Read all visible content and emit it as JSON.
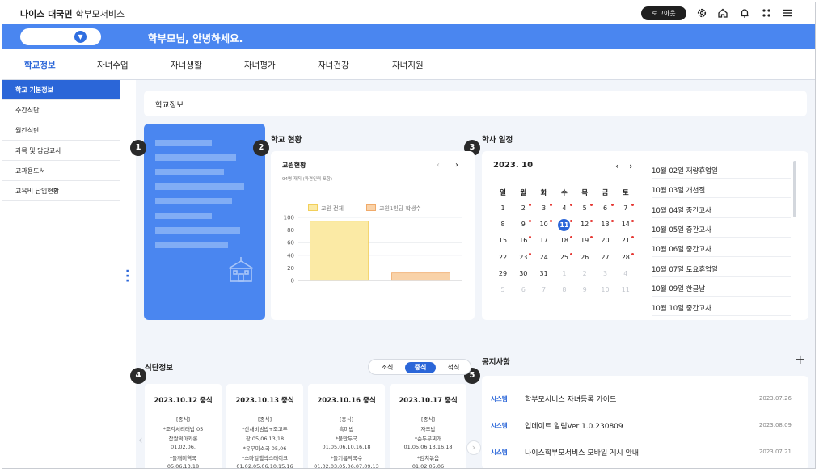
{
  "header": {
    "logo_brand": "나이스 대국민",
    "logo_service": "학부모서비스",
    "login_label": "로그아웃",
    "icons": [
      "gear-icon",
      "home-icon",
      "bell-icon",
      "apps-icon",
      "menu-icon"
    ]
  },
  "banner": {
    "greeting": "학부모님, 안녕하세요."
  },
  "nav": {
    "tabs": [
      {
        "label": "학교정보",
        "active": true
      },
      {
        "label": "자녀수업",
        "active": false
      },
      {
        "label": "자녀생활",
        "active": false
      },
      {
        "label": "자녀평가",
        "active": false
      },
      {
        "label": "자녀건강",
        "active": false
      },
      {
        "label": "자녀지원",
        "active": false
      }
    ]
  },
  "sidebar": {
    "items": [
      {
        "label": "학교 기본정보",
        "active": true
      },
      {
        "label": "주간식단",
        "active": false
      },
      {
        "label": "월간식단",
        "active": false
      },
      {
        "label": "과목 및 담당교사",
        "active": false
      },
      {
        "label": "교과용도서",
        "active": false
      },
      {
        "label": "교육비 납입현황",
        "active": false
      }
    ]
  },
  "page_title": "학교정보",
  "badges": [
    "1",
    "2",
    "3",
    "4",
    "5"
  ],
  "school_status": {
    "title": "학교 현황",
    "card_title": "교원현황",
    "card_sub": "94명 재직 (파견인력 포함)",
    "legend": [
      "교원 전체",
      "교원1인당 학생수"
    ],
    "y_ticks": [
      "100",
      "80",
      "60",
      "40",
      "20",
      "0"
    ]
  },
  "chart_data": {
    "type": "bar",
    "title": "교원현황",
    "categories": [
      "교원 전체",
      "교원1인당 학생수"
    ],
    "series": [
      {
        "name": "교원 전체",
        "values": [
          94,
          null
        ],
        "color": "#fbeaa5"
      },
      {
        "name": "교원1인당 학생수",
        "values": [
          null,
          12
        ],
        "color": "#f9d2a8"
      }
    ],
    "ylim": [
      0,
      100
    ],
    "y_ticks": [
      0,
      20,
      40,
      60,
      80,
      100
    ]
  },
  "calendar": {
    "title": "학사 일정",
    "month_label": "2023. 10",
    "weekdays": [
      "일",
      "월",
      "화",
      "수",
      "목",
      "금",
      "토"
    ],
    "weeks": [
      [
        {
          "d": "1"
        },
        {
          "d": "2",
          "dot": true
        },
        {
          "d": "3",
          "dot": true
        },
        {
          "d": "4",
          "dot": true
        },
        {
          "d": "5",
          "dot": true
        },
        {
          "d": "6",
          "dot": true
        },
        {
          "d": "7",
          "dot": true
        }
      ],
      [
        {
          "d": "8"
        },
        {
          "d": "9",
          "dot": true
        },
        {
          "d": "10",
          "dot": true
        },
        {
          "d": "11",
          "today": true,
          "dot": true
        },
        {
          "d": "12",
          "dot": true
        },
        {
          "d": "13",
          "dot": true
        },
        {
          "d": "14",
          "dot": true
        }
      ],
      [
        {
          "d": "15"
        },
        {
          "d": "16",
          "dot": true
        },
        {
          "d": "17"
        },
        {
          "d": "18",
          "dot": true
        },
        {
          "d": "19",
          "dot": true
        },
        {
          "d": "20"
        },
        {
          "d": "21",
          "dot": true
        }
      ],
      [
        {
          "d": "22"
        },
        {
          "d": "23",
          "dot": true
        },
        {
          "d": "24"
        },
        {
          "d": "25",
          "dot": true
        },
        {
          "d": "26"
        },
        {
          "d": "27"
        },
        {
          "d": "28",
          "dot": true
        }
      ],
      [
        {
          "d": "29"
        },
        {
          "d": "30"
        },
        {
          "d": "31"
        },
        {
          "d": "1",
          "gray": true
        },
        {
          "d": "2",
          "gray": true
        },
        {
          "d": "3",
          "gray": true
        },
        {
          "d": "4",
          "gray": true
        }
      ],
      [
        {
          "d": "5",
          "gray": true
        },
        {
          "d": "6",
          "gray": true
        },
        {
          "d": "7",
          "gray": true
        },
        {
          "d": "8",
          "gray": true
        },
        {
          "d": "9",
          "gray": true
        },
        {
          "d": "10",
          "gray": true
        },
        {
          "d": "11",
          "gray": true
        }
      ]
    ],
    "events": [
      "10월 02일 재량휴업일",
      "10월 03일 개천절",
      "10월 04일 중간고사",
      "10월 05일 중간고사",
      "10월 06일 중간고사",
      "10월 07일 토요휴업일",
      "10월 09일 한글날",
      "10월 10일 중간고사"
    ]
  },
  "meal": {
    "title": "식단정보",
    "segments": [
      {
        "label": "조식",
        "active": false
      },
      {
        "label": "중식",
        "active": true
      },
      {
        "label": "석식",
        "active": false
      }
    ],
    "cards": [
      {
        "date": "2023.10.12 중식",
        "lines": [
          "[중식]",
          "*조각서리태밥 05",
          "찹쌀떡아카롱",
          "01,02,06.",
          "*들깨미역국",
          "05,06,13,18"
        ]
      },
      {
        "date": "2023.10.13 중식",
        "lines": [
          "[중식]",
          "*산채비빔밥+조고추",
          "장 05,06,13,18",
          "*유부미소국 05,06",
          "*스마일햄박스테이크",
          "01,02,05,06,10,15,16"
        ]
      },
      {
        "date": "2023.10.16 중식",
        "lines": [
          "[중식]",
          "흑미밥",
          "*불만두국",
          "01,05,06,10,16,18",
          "*들기름막국수",
          "01,02,03,05,06,07,09,13"
        ]
      },
      {
        "date": "2023.10.17 중식",
        "lines": [
          "[중식]",
          "자조밥",
          "*순두부찌개",
          "01,05,06,13,16,18",
          "*김치볶음",
          "01,02,05,06"
        ]
      }
    ]
  },
  "notice": {
    "title": "공지사항",
    "add_label": "+",
    "items": [
      {
        "category": "시스템",
        "title": "학부모서비스 자녀등록 가이드",
        "date": "2023.07.26"
      },
      {
        "category": "시스템",
        "title": "업데이트 알림Ver 1.0.230809",
        "date": "2023.08.09"
      },
      {
        "category": "시스템",
        "title": "나이스학부모서비스 모바일 게시 안내",
        "date": "2023.07.21"
      }
    ]
  },
  "colors": {
    "brand_blue": "#4a86f0",
    "active_blue": "#2b66d8",
    "bar_total": "#fbeaa5",
    "bar_ratio": "#f9d2a8",
    "dot_red": "#e53935"
  }
}
